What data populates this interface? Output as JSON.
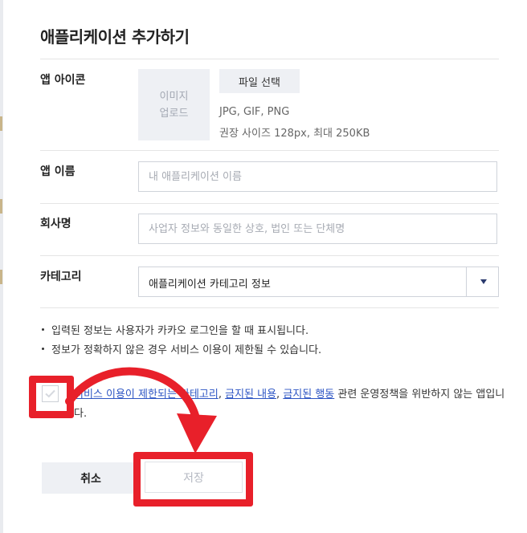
{
  "modal": {
    "title": "애플리케이션 추가하기"
  },
  "app_icon": {
    "label": "앱 아이콘",
    "placeholder_line1": "이미지",
    "placeholder_line2": "업로드",
    "file_button": "파일 선택",
    "hint_formats": "JPG, GIF, PNG",
    "hint_size": "권장 사이즈 128px, 최대 250KB"
  },
  "app_name": {
    "label": "앱 이름",
    "placeholder": "내 애플리케이션 이름"
  },
  "company": {
    "label": "회사명",
    "placeholder": "사업자 정보와 동일한 상호, 법인 또는 단체명"
  },
  "category": {
    "label": "카테고리",
    "selected": "애플리케이션 카테고리 정보"
  },
  "notes": [
    "입력된 정보는 사용자가 카카오 로그인을 할 때 표시됩니다.",
    "정보가 정확하지 않은 경우 서비스 이용이 제한될 수 있습니다."
  ],
  "consent": {
    "checked": false,
    "link1": "서비스 이용이 제한되는 카테고리",
    "sep1": ", ",
    "link2": "금지된 내용",
    "sep2": ", ",
    "link3": "금지된 행동",
    "text_after": " 관련 운영정책을 위반하지 않는 앱입니다."
  },
  "buttons": {
    "cancel": "취소",
    "save": "저장"
  },
  "colors": {
    "annotation": "#e8202a",
    "link": "#2e56c4"
  }
}
